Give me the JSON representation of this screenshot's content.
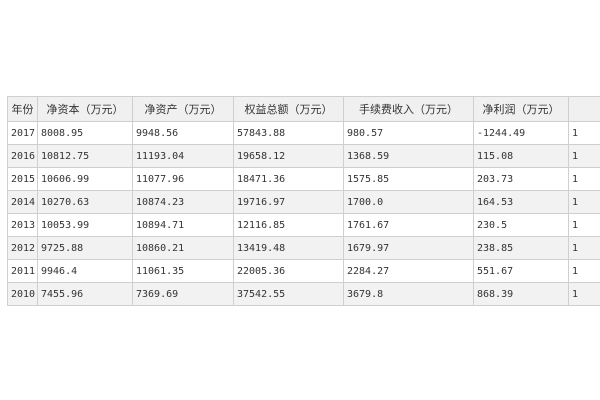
{
  "table": {
    "headers": [
      "年份",
      "净资本（万元）",
      "净资产（万元）",
      "权益总额（万元）",
      "手续费收入（万元）",
      "净利润（万元）",
      ""
    ],
    "rows": [
      [
        "2017",
        "8008.95",
        "9948.56",
        "57843.88",
        "980.57",
        "-1244.49",
        "1"
      ],
      [
        "2016",
        "10812.75",
        "11193.04",
        "19658.12",
        "1368.59",
        "115.08",
        "1"
      ],
      [
        "2015",
        "10606.99",
        "11077.96",
        "18471.36",
        "1575.85",
        "203.73",
        "1"
      ],
      [
        "2014",
        "10270.63",
        "10874.23",
        "19716.97",
        "1700.0",
        "164.53",
        "1"
      ],
      [
        "2013",
        "10053.99",
        "10894.71",
        "12116.85",
        "1761.67",
        "230.5",
        "1"
      ],
      [
        "2012",
        "9725.88",
        "10860.21",
        "13419.48",
        "1679.97",
        "238.85",
        "1"
      ],
      [
        "2011",
        "9946.4",
        "11061.35",
        "22005.36",
        "2284.27",
        "551.67",
        "1"
      ],
      [
        "2010",
        "7455.96",
        "7369.69",
        "37542.55",
        "3679.8",
        "868.39",
        "1"
      ]
    ]
  }
}
